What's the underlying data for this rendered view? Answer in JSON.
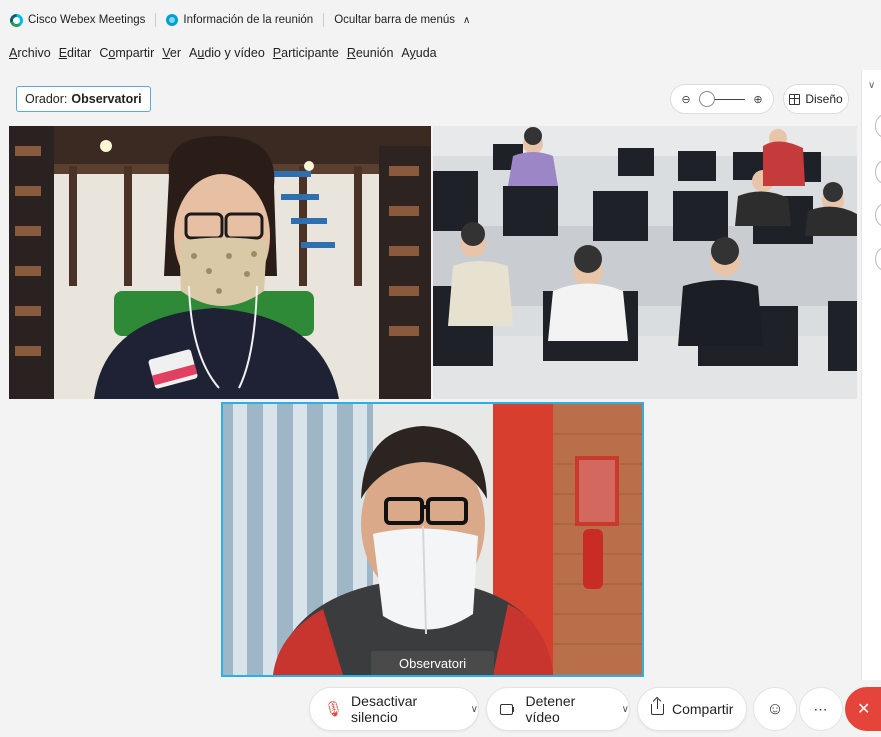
{
  "titlebar": {
    "app_name": "Cisco Webex Meetings",
    "meeting_info": "Información de la reunión",
    "hide_menu": "Ocultar barra de menús"
  },
  "menu": {
    "items": [
      {
        "accel": "A",
        "rest": "rchivo"
      },
      {
        "accel": "E",
        "rest": "ditar"
      },
      {
        "pre": "C",
        "accel": "o",
        "rest": "mpartir"
      },
      {
        "accel": "V",
        "rest": "er"
      },
      {
        "pre": "A",
        "accel": "u",
        "rest": "dio y vídeo"
      },
      {
        "accel": "P",
        "rest": "articipante"
      },
      {
        "accel": "R",
        "rest": "eunión"
      },
      {
        "pre": "A",
        "accel": "y",
        "rest": "uda"
      }
    ]
  },
  "speaker": {
    "label": "Orador:",
    "name": "Observatori"
  },
  "zoom": {
    "zoom_out_icon": "zoom-out-icon",
    "zoom_in_icon": "zoom-in-icon",
    "level": 0.0
  },
  "layout": {
    "label": "Diseño"
  },
  "tiles": [
    {
      "id": "participant-woman",
      "name": ""
    },
    {
      "id": "classroom",
      "name": ""
    },
    {
      "id": "active-speaker",
      "name": "Observatori"
    }
  ],
  "controls": {
    "mute_label": "Desactivar silencio",
    "video_label": "Detener vídeo",
    "share_label": "Compartir",
    "reactions_icon": "smiley-icon",
    "more_icon": "more-icon",
    "end_icon": "close-icon"
  },
  "colors": {
    "accent": "#29b1e6",
    "end_call": "#e5443b",
    "mic_muted": "#e0483e"
  }
}
